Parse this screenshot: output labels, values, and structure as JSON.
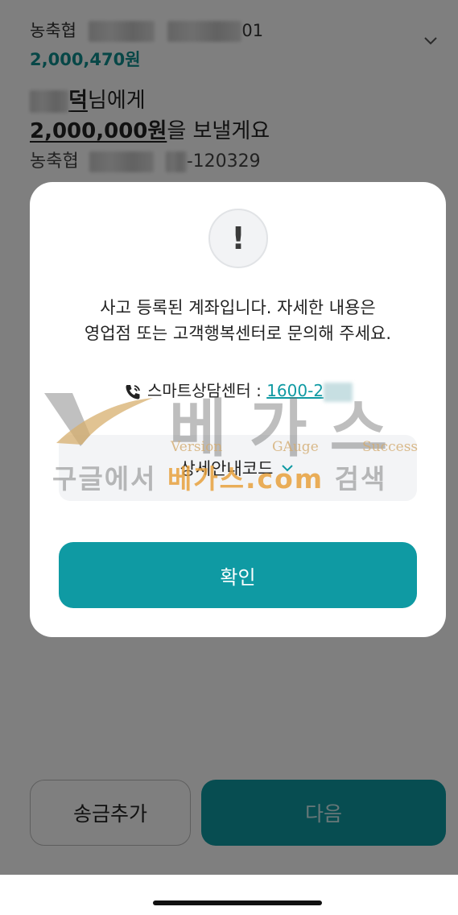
{
  "account": {
    "bank": "농축협",
    "number_suffix": "01",
    "balance": "2,000,470원"
  },
  "transfer": {
    "recipient_name_visible": "덕",
    "recipient_suffix": "님에게",
    "amount": "2,000,000원",
    "amount_suffix": "을 보낼게요",
    "dest_bank": "농축협",
    "dest_number_suffix": "-120329"
  },
  "modal": {
    "alert_symbol": "!",
    "message_line1": "사고 등록된 계좌입니다. 자세한 내용은",
    "message_line2": "영업점 또는 고객행복센터로 문의해 주세요.",
    "phone_label": "스마트상담센터 : ",
    "phone_number": "1600-2",
    "detail_code_label": "상세안내코드",
    "ok_button": "확인"
  },
  "watermark": {
    "brand": "베가스",
    "sub1": "Version",
    "sub2": "GAuge",
    "sub3": "Success",
    "line_prefix": "구글에서 ",
    "line_highlight": "베가스.com",
    "line_suffix": " 검색"
  },
  "buttons": {
    "add_transfer": "송금추가",
    "next": "다음"
  },
  "colors": {
    "accent": "#0f9aa3",
    "balance": "#0f8f8f"
  },
  "icons": [
    "chevron-down-icon",
    "alert-icon",
    "phone-icon"
  ]
}
